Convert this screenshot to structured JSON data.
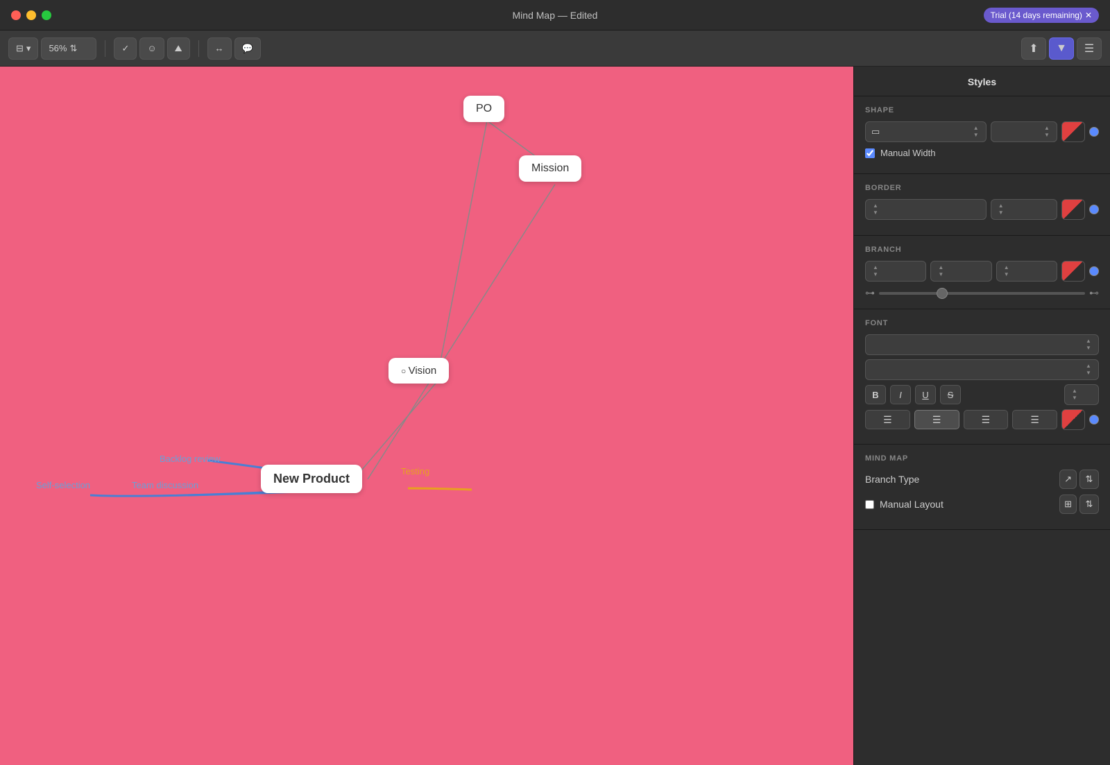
{
  "titlebar": {
    "title": "Mind Map — Edited",
    "trial_label": "Trial (14 days remaining)"
  },
  "toolbar": {
    "zoom_value": "56%",
    "buttons": [
      "✓",
      "☺",
      "⛰",
      "↔",
      "💬"
    ]
  },
  "canvas": {
    "nodes": {
      "po": "PO",
      "mission": "Mission",
      "vision": "Vision",
      "new_product": "New Product"
    },
    "labels": {
      "backlog_review": "Backlog review",
      "testing": "Testing",
      "self_selection": "Self-selection",
      "team_discussion": "Team discussion"
    }
  },
  "panel": {
    "title": "Styles",
    "sections": {
      "shape": "SHAPE",
      "border": "BORDER",
      "branch": "BRANCH",
      "font": "FONT",
      "mind_map": "MIND MAP"
    },
    "manual_width_label": "Manual Width",
    "branch_type_label": "Branch Type",
    "manual_layout_label": "Manual Layout",
    "font_bold": "B",
    "font_italic": "I",
    "font_underline": "U",
    "font_strike": "S",
    "align_left": "≡",
    "align_center": "≡",
    "align_right": "≡",
    "align_justify": "≡"
  }
}
